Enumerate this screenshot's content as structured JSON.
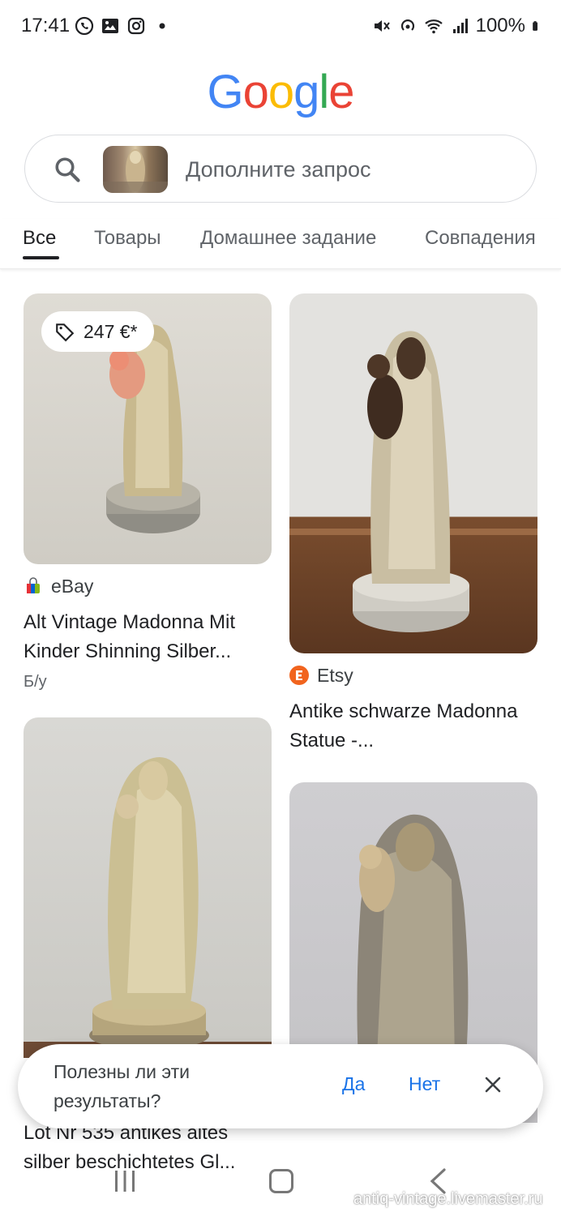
{
  "status_bar": {
    "time": "17:41",
    "battery": "100%"
  },
  "logo": {
    "letters": [
      "G",
      "o",
      "o",
      "g",
      "l",
      "e"
    ],
    "colors": [
      "#4285F4",
      "#EA4335",
      "#FBBC05",
      "#4285F4",
      "#34A853",
      "#EA4335"
    ]
  },
  "search": {
    "placeholder": "Дополните запрос"
  },
  "tabs": [
    {
      "label": "Все",
      "active": true
    },
    {
      "label": "Товары",
      "active": false
    },
    {
      "label": "Домашнее задание",
      "active": false
    },
    {
      "label": "Совпадения",
      "active": false
    }
  ],
  "results": [
    {
      "price": "247 €*",
      "source": "eBay",
      "title": "Alt Vintage Madonna Mit Kinder Shinning Silber...",
      "subtitle": "Б/у"
    },
    {
      "source": "Etsy",
      "title": "Antike schwarze Madonna Statue -..."
    },
    {
      "title": "Lot Nr 535 antikes altes silber beschichtetes Gl..."
    },
    {}
  ],
  "feedback": {
    "question": "Полезны ли эти результаты?",
    "yes": "Да",
    "no": "Нет"
  },
  "watermark": "antiq-vintage.livemaster.ru",
  "colors": {
    "link_blue": "#1a73e8",
    "text_primary": "#202124",
    "text_secondary": "#5f6368"
  }
}
